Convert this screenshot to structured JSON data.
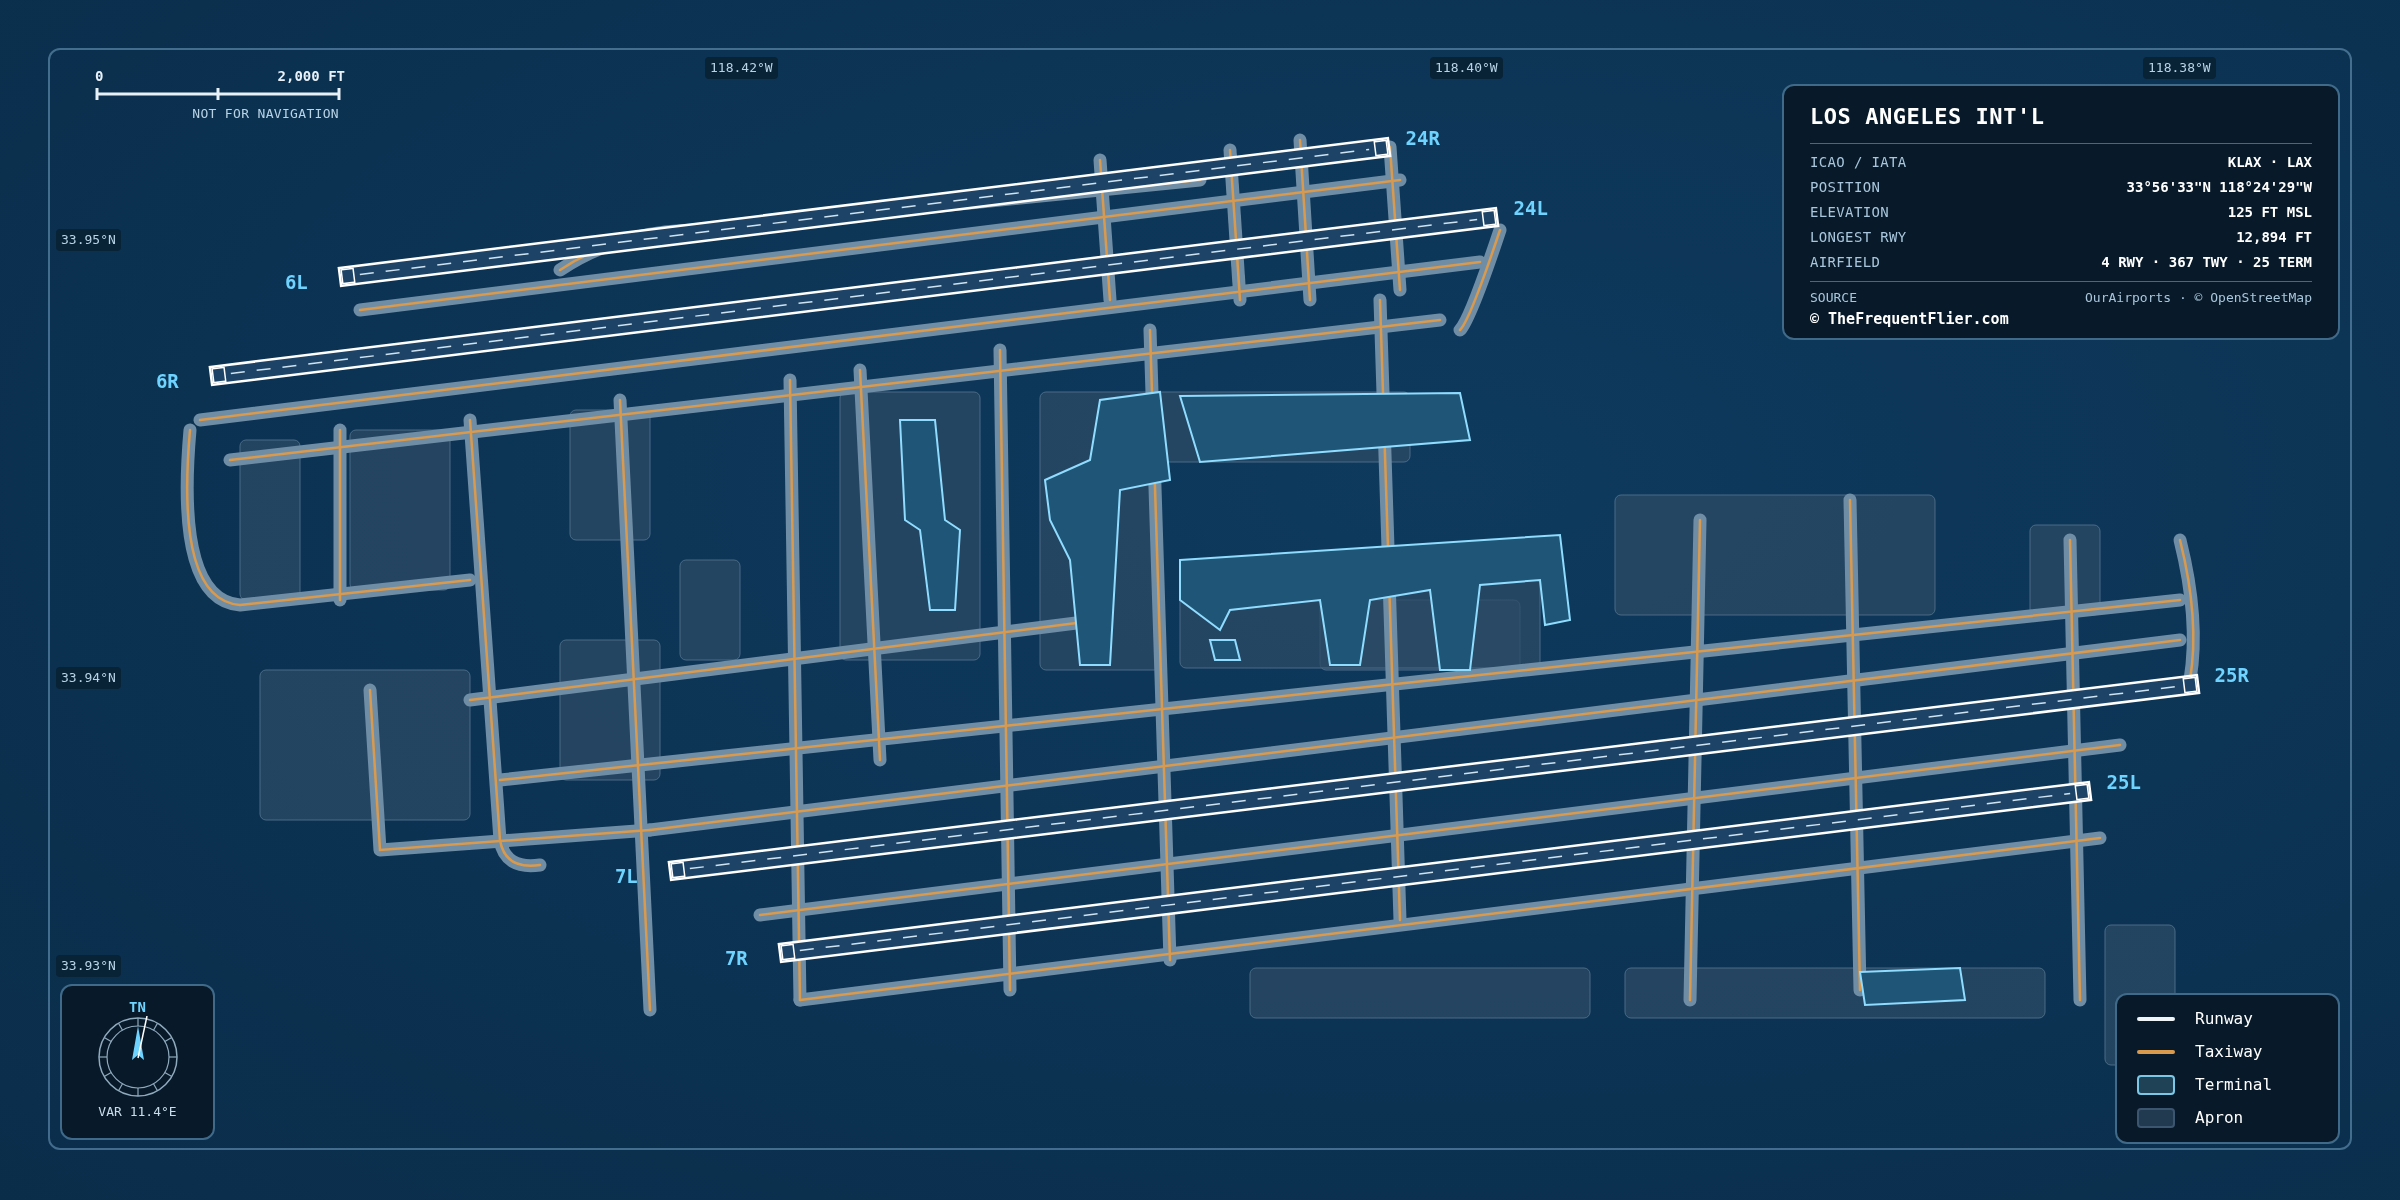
{
  "scale_bar": {
    "start": "0",
    "end": "2,000 FT",
    "note": "NOT FOR NAVIGATION"
  },
  "longitude_labels": [
    "118.42°W",
    "118.40°W",
    "118.38°W"
  ],
  "latitude_labels": [
    "33.95°N",
    "33.94°N",
    "33.93°N"
  ],
  "runways": [
    {
      "start_label": "6L",
      "end_label": "24R"
    },
    {
      "start_label": "6R",
      "end_label": "24L"
    },
    {
      "start_label": "7L",
      "end_label": "25R"
    },
    {
      "start_label": "7R",
      "end_label": "25L"
    }
  ],
  "info_panel": {
    "title": "LOS ANGELES INT'L",
    "rows": [
      {
        "label": "ICAO / IATA",
        "value": "KLAX · LAX"
      },
      {
        "label": "POSITION",
        "value": "33°56'33\"N 118°24'29\"W"
      },
      {
        "label": "ELEVATION",
        "value": "125 FT MSL"
      },
      {
        "label": "LONGEST RWY",
        "value": "12,894 FT"
      },
      {
        "label": "AIRFIELD",
        "value": "4 RWY · 367 TWY · 25 TERM"
      }
    ],
    "source_label": "SOURCE",
    "source_value": "OurAirports · © OpenStreetMap",
    "credit": "© TheFrequentFlier.com"
  },
  "compass": {
    "label": "TN",
    "variation": "VAR 11.4°E"
  },
  "legend": [
    {
      "kind": "runway",
      "label": "Runway"
    },
    {
      "kind": "taxiway",
      "label": "Taxiway"
    },
    {
      "kind": "terminal",
      "label": "Terminal"
    },
    {
      "kind": "apron",
      "label": "Apron"
    }
  ]
}
